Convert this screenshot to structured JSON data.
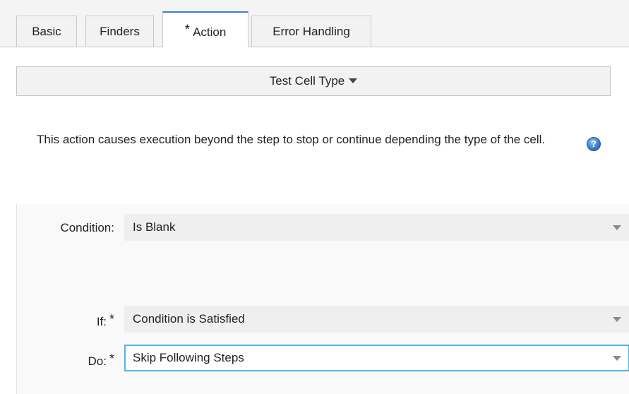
{
  "tabs": [
    {
      "label": "Basic",
      "required": false
    },
    {
      "label": "Finders",
      "required": false
    },
    {
      "label": "Action",
      "required": true,
      "active": true
    },
    {
      "label": "Error Handling",
      "required": false
    }
  ],
  "required_marker": "*",
  "action_type": {
    "label": "Test Cell Type"
  },
  "description": "This action causes execution beyond the step to stop or continue depending the type of the cell.",
  "help_icon": {
    "glyph": "?"
  },
  "form": {
    "condition": {
      "label": "Condition:",
      "value": "Is Blank"
    },
    "if": {
      "label": "If:",
      "value": "Condition is Satisfied"
    },
    "do": {
      "label": "Do:",
      "value": "Skip Following Steps"
    }
  },
  "colors": {
    "active_tab_accent": "#3a7fd0",
    "focus_border": "#52b3e6",
    "help_icon": "#2a6fbf"
  }
}
